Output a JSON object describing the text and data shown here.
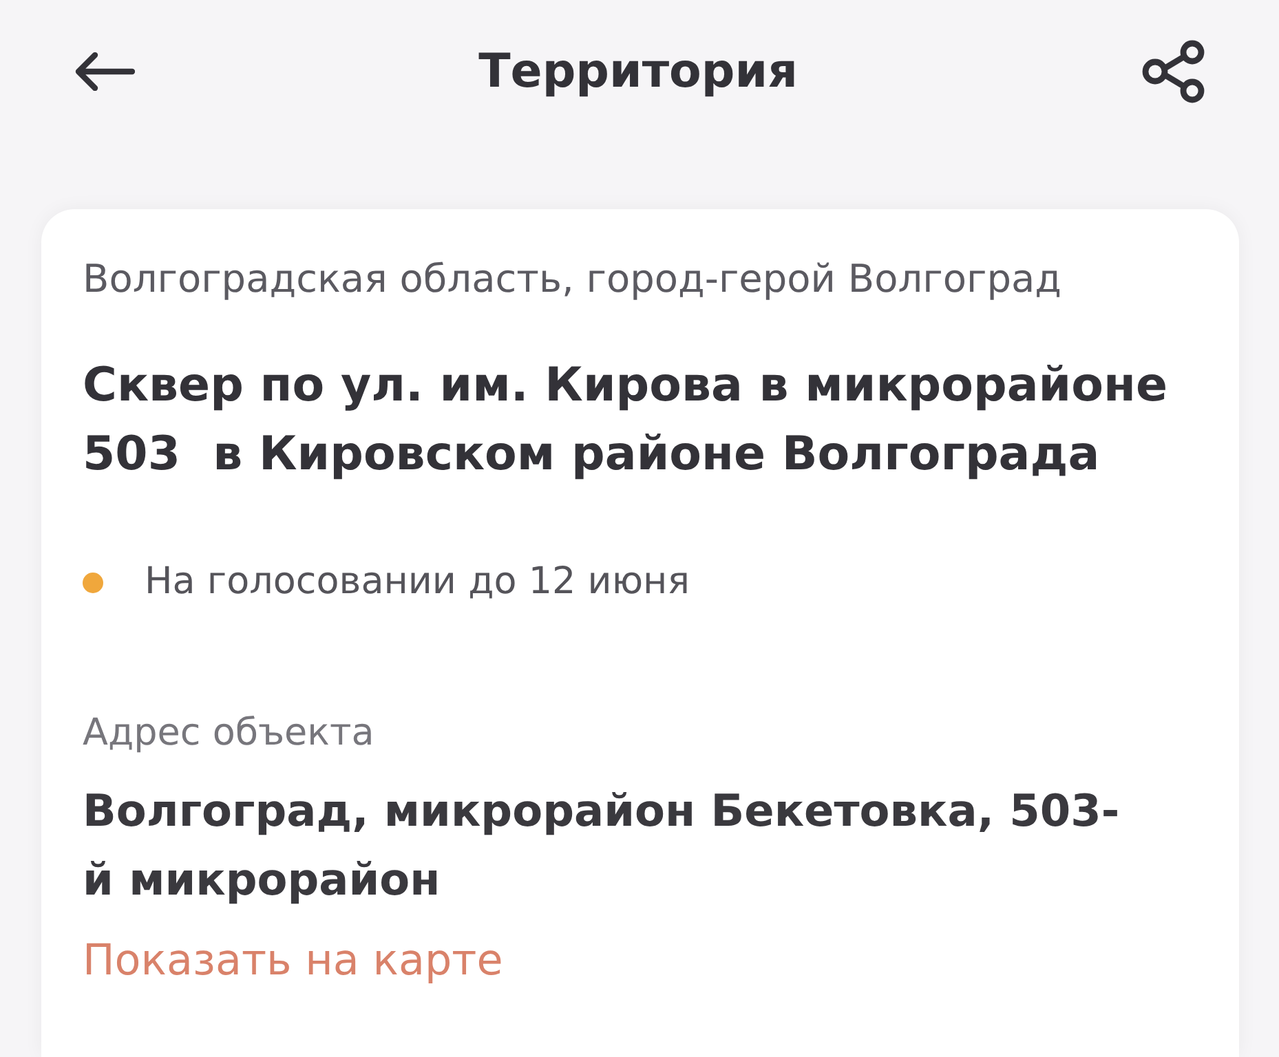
{
  "header": {
    "title": "Территория"
  },
  "card": {
    "region": "Волгоградская область, город-герой Волгоград",
    "title": "Сквер по ул. им. Кирова в микрорайоне 503  в Кировском районе Волгограда",
    "status": {
      "text": "На голосовании до 12 июня",
      "color": "#f0a73c"
    },
    "address": {
      "label": "Адрес объекта",
      "value": "Волгоград, микрорайон Бекетовка, 503-й микрорайон"
    },
    "map_link": "Показать на карте"
  }
}
